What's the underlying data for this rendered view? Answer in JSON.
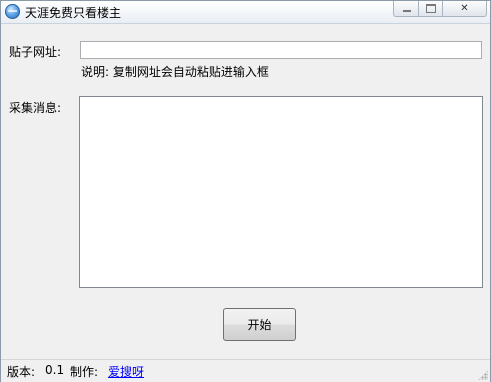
{
  "window": {
    "title": "天涯免费只看楼主",
    "controls": {
      "minimize": "",
      "maximize": "",
      "close": "✕"
    }
  },
  "form": {
    "url_label": "贴子网址:",
    "url_value": "",
    "url_hint": "说明: 复制网址会自动粘贴进输入框",
    "messages_label": "采集消息:",
    "messages_value": "",
    "start_button": "开始"
  },
  "status": {
    "version_label": "版本:",
    "version_value": "0.1",
    "author_label": "制作:",
    "author_link": "爱搜呀"
  },
  "icons": {
    "app": "app-globe-icon",
    "minimize": "minimize-icon",
    "maximize": "maximize-icon",
    "close": "close-icon",
    "grip": "resize-grip-icon"
  }
}
